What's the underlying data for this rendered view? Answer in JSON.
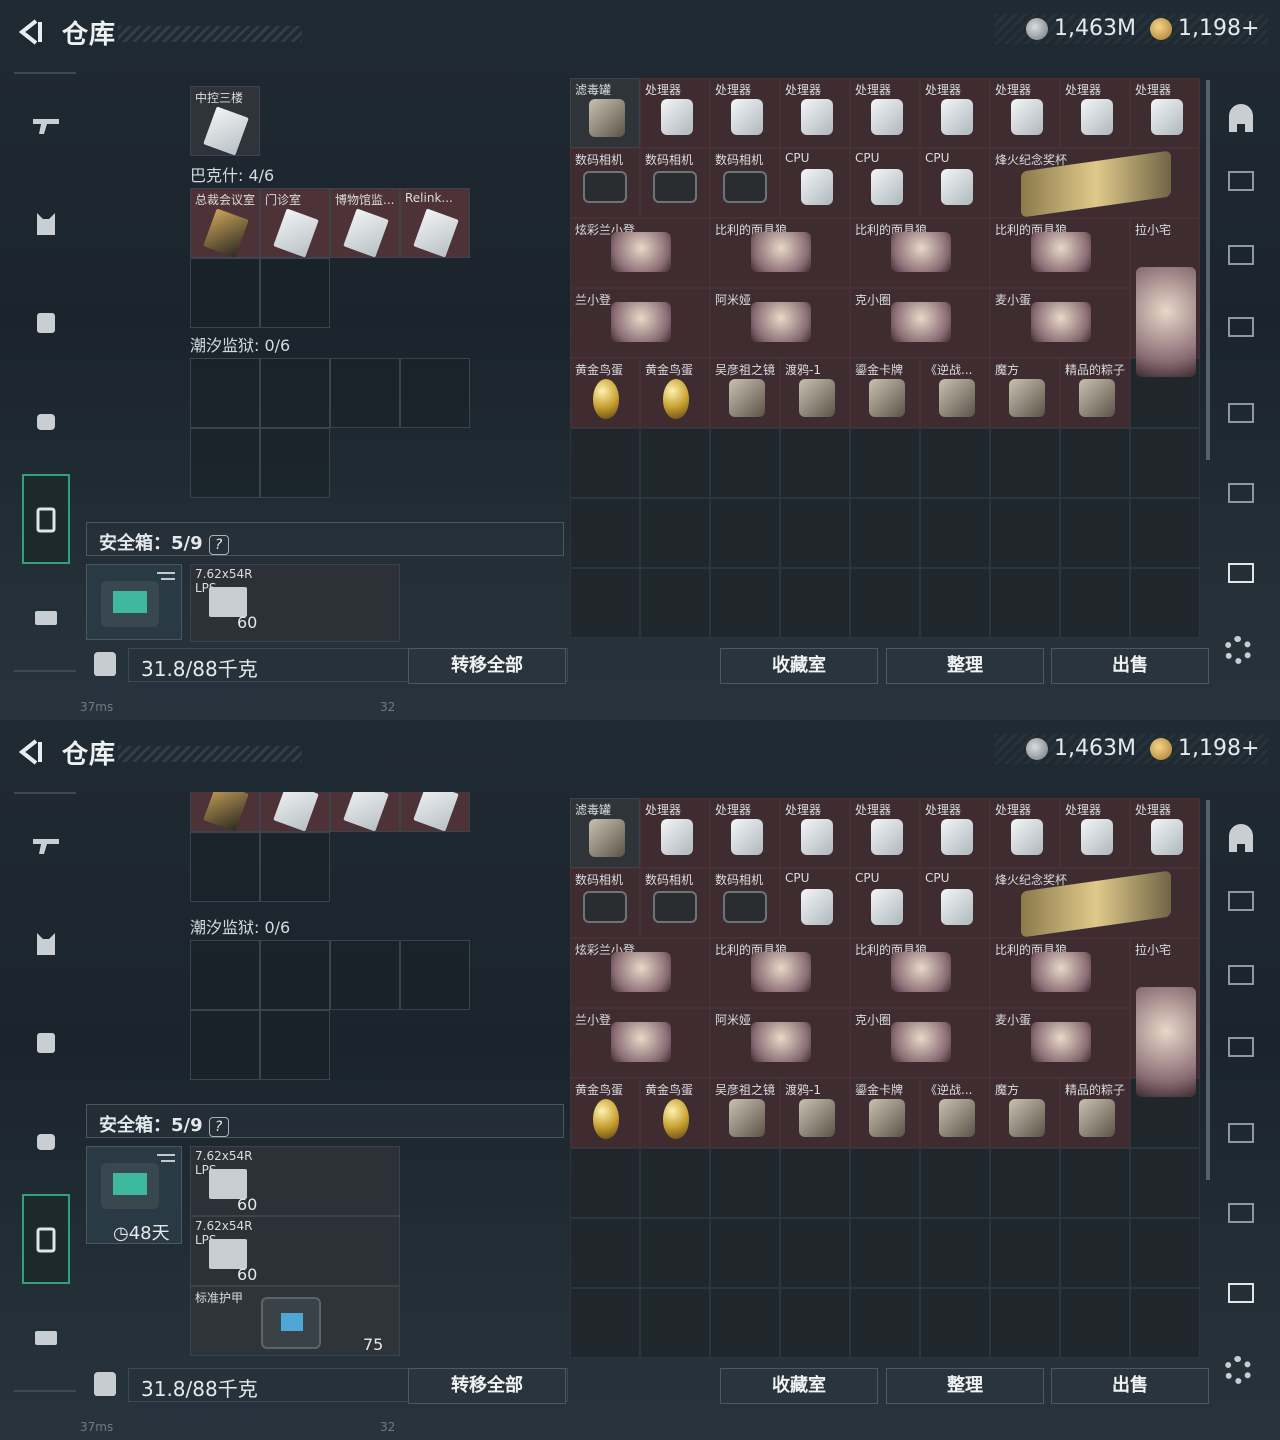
{
  "header": {
    "title": "仓库",
    "silver": "1,463M",
    "gold": "1,198+"
  },
  "sidebar": {
    "items": [
      "gun-icon",
      "vest-icon",
      "backpack-icon",
      "bag-icon",
      "safebox-icon",
      "briefcase-icon"
    ]
  },
  "left": {
    "s1_top_cell": "中控三楼",
    "bakeshi": "巴克什: 4/6",
    "bakeshi_items": [
      "总裁会议室",
      "门诊室",
      "博物馆监...",
      "Relink..."
    ],
    "chaoxi": "潮汐监狱: 0/6",
    "safebox_label": "安全箱：5/9",
    "ammo_name": "7.62x54R",
    "ammo_sub": "LPS",
    "ammo_count": "60",
    "armor_name": "标准护甲",
    "armor_value": "75",
    "case_timer": "48天"
  },
  "grid": {
    "row1": [
      "滤毒罐",
      "处理器",
      "处理器",
      "处理器",
      "处理器",
      "处理器",
      "处理器",
      "处理器",
      "处理器"
    ],
    "row2": [
      "数码相机",
      "数码相机",
      "数码相机",
      "CPU",
      "CPU",
      "CPU",
      "烽火纪念奖杯"
    ],
    "row3": [
      "炫彩兰小登",
      "比利的面具狼",
      "比利的面具狼",
      "比利的面具狼",
      "拉小宅"
    ],
    "row4": [
      "兰小登",
      "阿米娅",
      "克小圈",
      "麦小蛋"
    ],
    "row5": [
      "黄金鸟蛋",
      "黄金鸟蛋",
      "吴彦祖之镜",
      "渡鸦-1",
      "鎏金卡牌",
      "《逆战...",
      "魔方",
      "精品的粽子"
    ]
  },
  "bottom": {
    "weight": "31.8/88千克",
    "transfer": "转移全部",
    "collection": "收藏室",
    "sort": "整理",
    "sell": "出售"
  },
  "status": {
    "ping": "37ms",
    "num": "32"
  },
  "colors": {
    "accent": "#2fa27c",
    "item_red": "#4d3237",
    "panel": "#1f262c"
  }
}
